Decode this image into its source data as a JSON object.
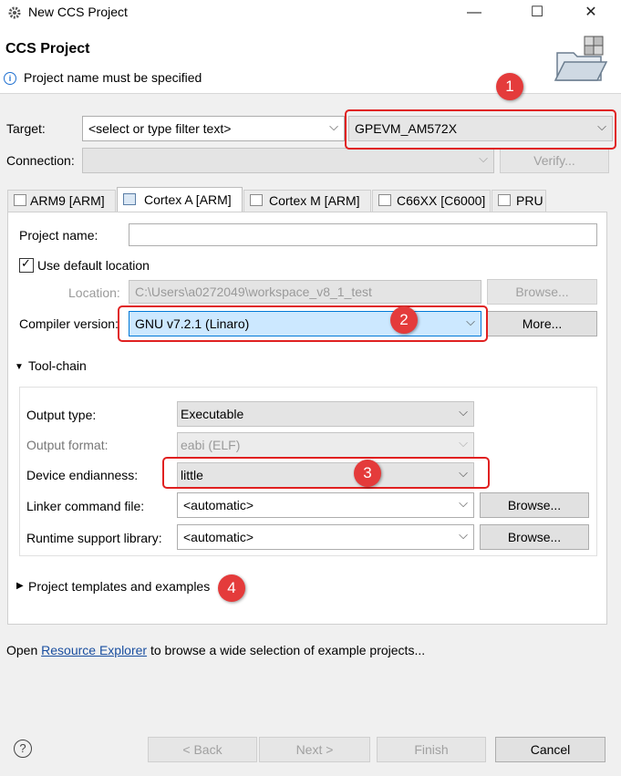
{
  "window": {
    "title": "New CCS Project",
    "minimize_glyph": "—",
    "maximize_glyph": "☐",
    "close_glyph": "✕"
  },
  "header": {
    "title": "CCS Project",
    "message": "Project name must be specified",
    "info_glyph": "i"
  },
  "target": {
    "label": "Target:",
    "filter_placeholder": "<select or type filter text>",
    "value": "GPEVM_AM572X"
  },
  "connection": {
    "label": "Connection:",
    "value": "",
    "verify_label": "Verify..."
  },
  "tabs": [
    {
      "label": "ARM9 [ARM]",
      "active": false
    },
    {
      "label": "Cortex A [ARM]",
      "active": true
    },
    {
      "label": "Cortex M [ARM]",
      "active": false
    },
    {
      "label": "C66XX [C6000]",
      "active": false
    },
    {
      "label": "PRU",
      "active": false
    }
  ],
  "form": {
    "project_name_label": "Project name:",
    "project_name_value": "",
    "use_default_label": "Use default location",
    "use_default_checked": true,
    "location_label": "Location:",
    "location_value": "C:\\Users\\a0272049\\workspace_v8_1_test",
    "browse_label": "Browse...",
    "compiler_label": "Compiler version:",
    "compiler_value": "GNU v7.2.1 (Linaro)",
    "more_label": "More..."
  },
  "toolchain": {
    "heading": "Tool-chain",
    "output_type_label": "Output type:",
    "output_type_value": "Executable",
    "output_format_label": "Output format:",
    "output_format_value": "eabi (ELF)",
    "endianness_label": "Device endianness:",
    "endianness_value": "little",
    "linker_label": "Linker command file:",
    "linker_value": "<automatic>",
    "linker_browse": "Browse...",
    "runtime_label": "Runtime support library:",
    "runtime_value": "<automatic>",
    "runtime_browse": "Browse..."
  },
  "templates": {
    "heading": "Project templates and examples"
  },
  "footer_text": {
    "prefix": "Open",
    "link": "Resource Explorer",
    "suffix": "to browse a wide selection of example projects..."
  },
  "buttons": {
    "help": "?",
    "back": "< Back",
    "next": "Next >",
    "finish": "Finish",
    "cancel": "Cancel"
  },
  "annotations": [
    "1",
    "2",
    "3",
    "4"
  ],
  "colors": {
    "highlight_border": "#e02020",
    "badge_fill": "#e43b3b",
    "selection_blue": "#cce8ff",
    "link": "#1a4fa0"
  }
}
